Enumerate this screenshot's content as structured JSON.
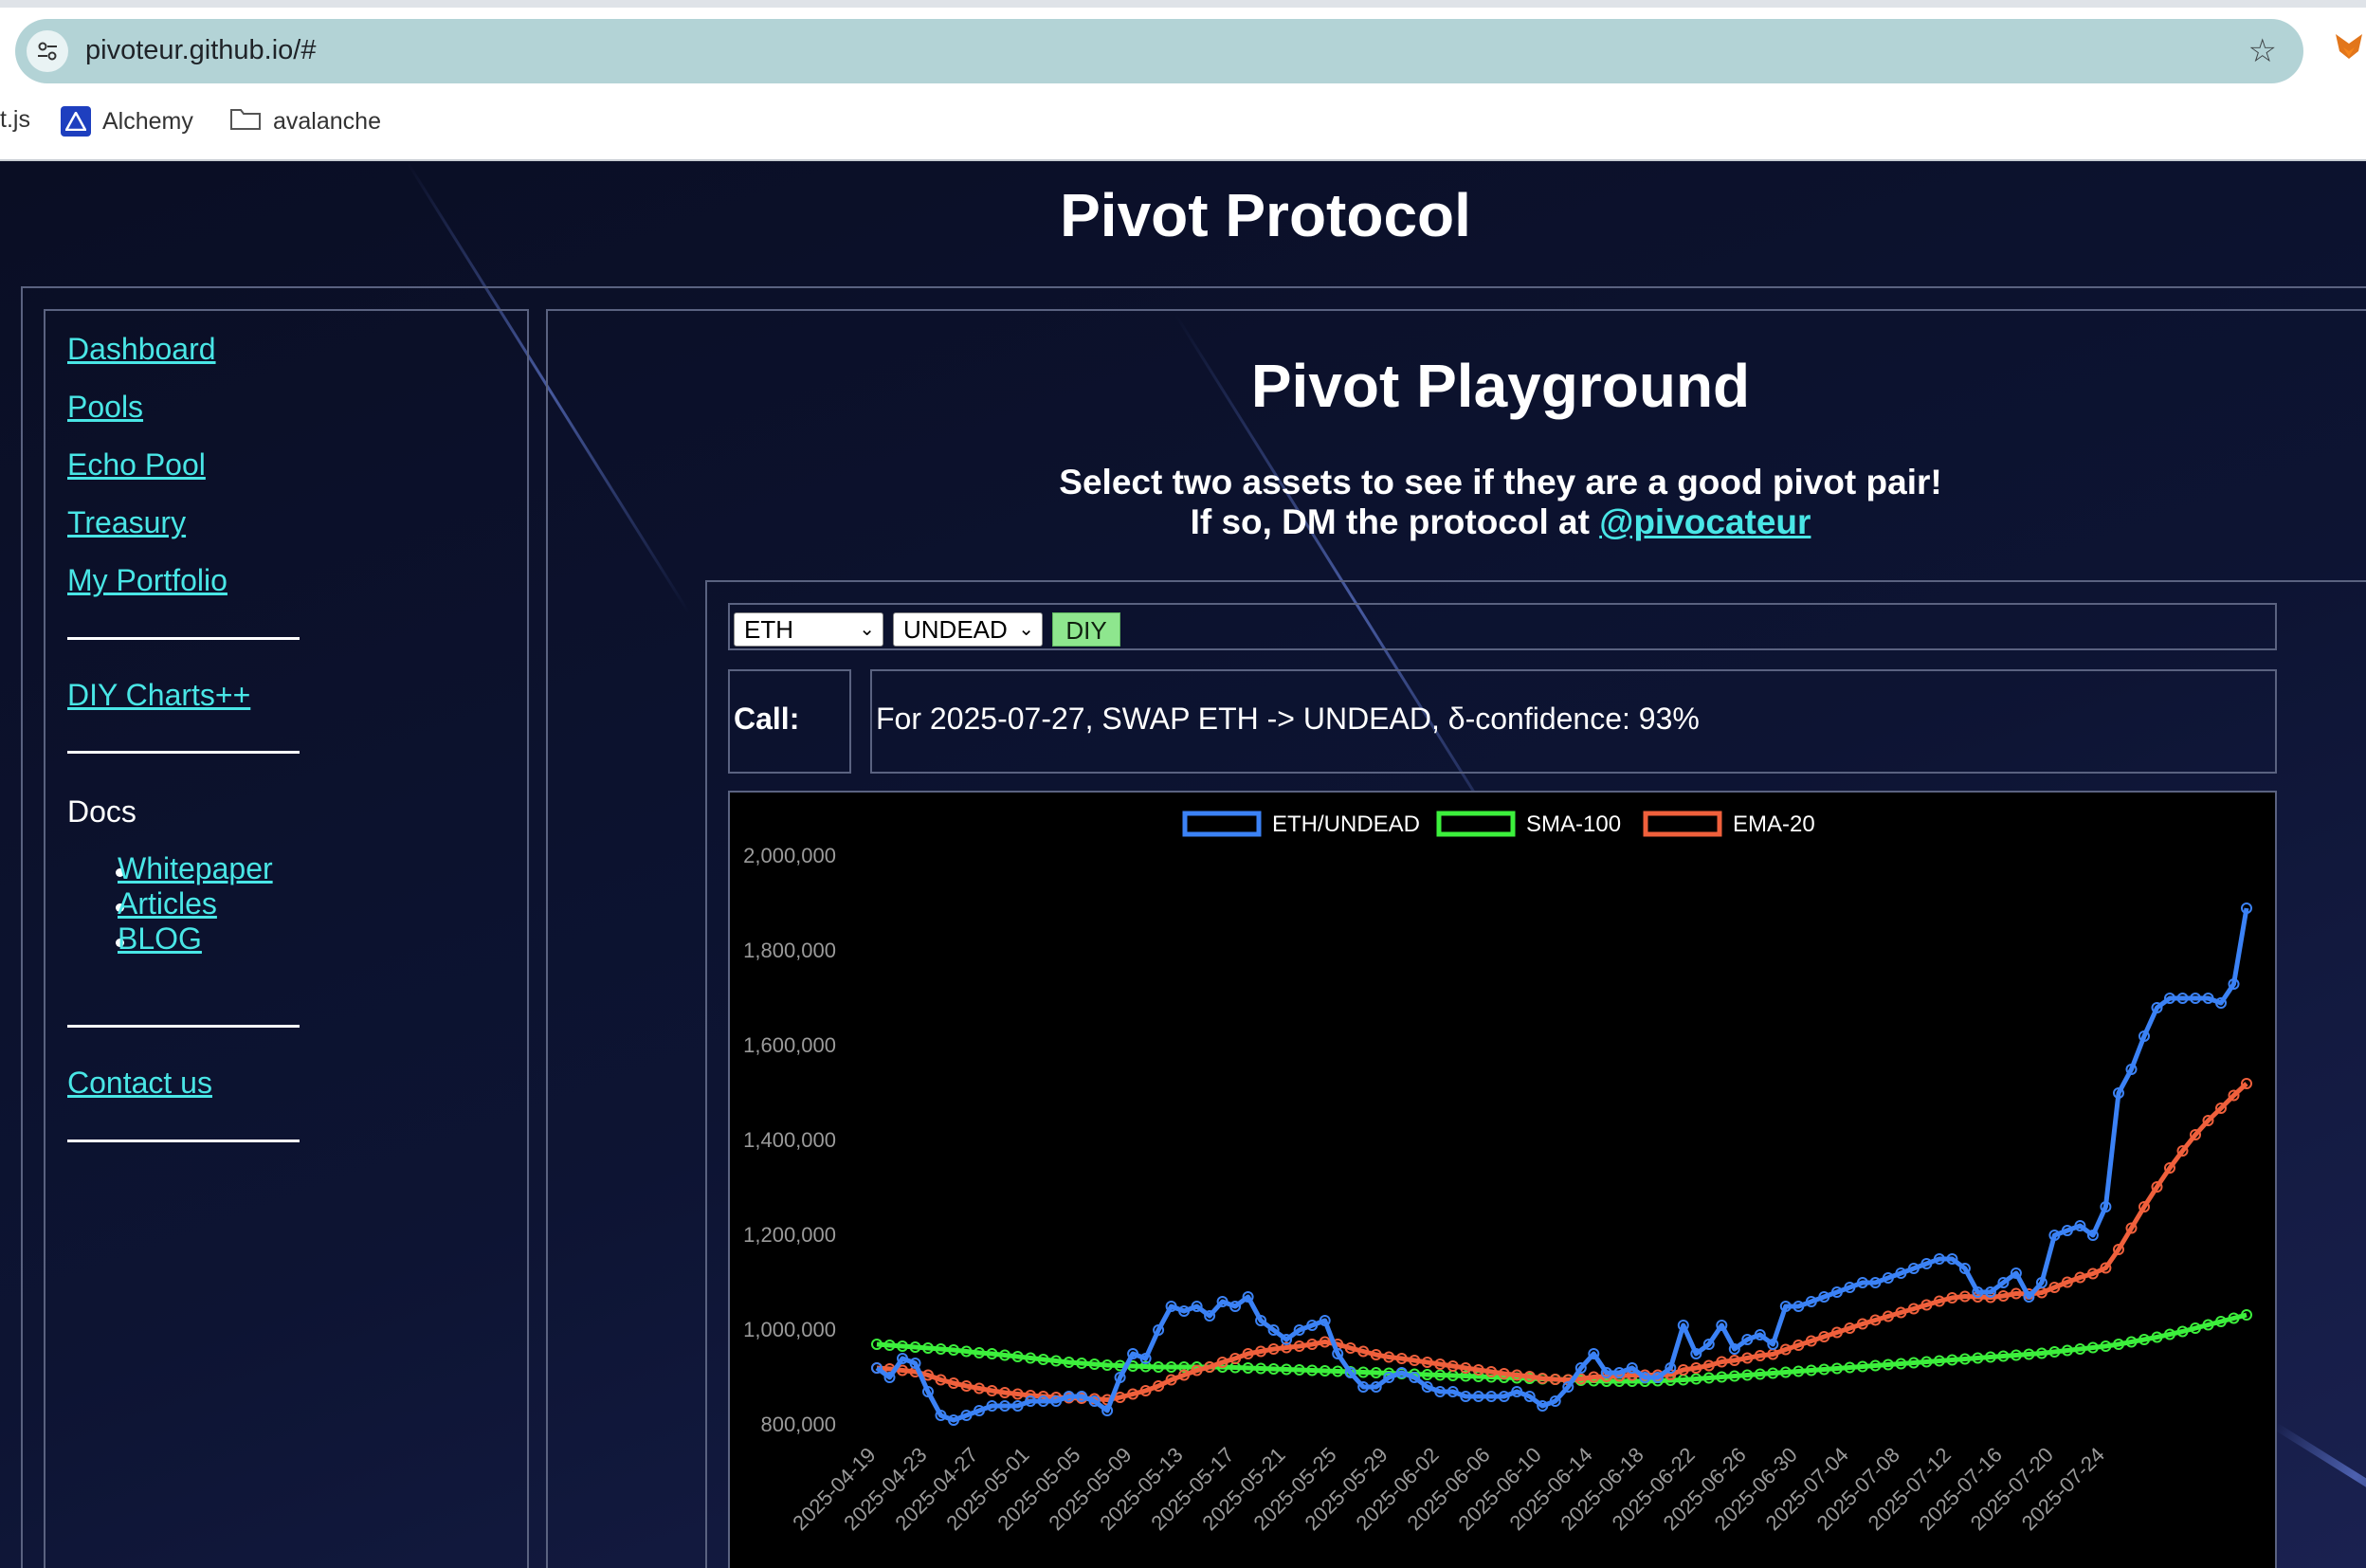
{
  "browser": {
    "url": "pivoteur.github.io/#",
    "bookmarks": [
      {
        "label": "t.js"
      },
      {
        "label": "Alchemy"
      },
      {
        "label": "avalanche"
      }
    ]
  },
  "site": {
    "title": "Pivot Protocol"
  },
  "sidebar": {
    "links": [
      {
        "label": "Dashboard"
      },
      {
        "label": "Pools"
      },
      {
        "label": "Echo Pool"
      },
      {
        "label": "Treasury"
      },
      {
        "label": "My Portfolio"
      }
    ],
    "diy": "DIY Charts++",
    "docs_label": "Docs",
    "docs": [
      "Whitepaper",
      "Articles",
      "BLOG"
    ],
    "contact": "Contact us"
  },
  "playground": {
    "title": "Pivot Playground",
    "subtitle1": "Select two assets to see if they are a good pivot pair!",
    "subtitle2_prefix": "If so, DM the protocol at ",
    "handle": "@pivocateur",
    "asset_a": "ETH",
    "asset_b": "UNDEAD",
    "diy_button": "DIY",
    "call_label": "Call:",
    "call_text": "For 2025-07-27, SWAP ETH -> UNDEAD, δ-confidence: 93%"
  },
  "colors": {
    "link": "#49e6e6",
    "eth_undead": "#3b82f6",
    "sma": "#3cf03c",
    "ema": "#f0603c"
  },
  "chart_data": {
    "type": "line",
    "ylim": [
      750000,
      2000000
    ],
    "yticks": [
      "800,000",
      "1,000,000",
      "1,200,000",
      "1,400,000",
      "1,600,000",
      "1,800,000",
      "2,000,000"
    ],
    "ytick_values": [
      800000,
      1000000,
      1200000,
      1400000,
      1600000,
      1800000,
      2000000
    ],
    "xtick_labels": [
      "2025-04-19",
      "2025-04-23",
      "2025-04-27",
      "2025-05-01",
      "2025-05-05",
      "2025-05-09",
      "2025-05-13",
      "2025-05-17",
      "2025-05-21",
      "2025-05-25",
      "2025-05-29",
      "2025-06-02",
      "2025-06-06",
      "2025-06-10",
      "2025-06-14",
      "2025-06-18",
      "2025-06-22",
      "2025-06-26",
      "2025-06-30",
      "2025-07-04",
      "2025-07-08",
      "2025-07-12",
      "2025-07-16",
      "2025-07-20",
      "2025-07-24"
    ],
    "x_start": "2025-04-19",
    "x_end": "2025-07-27",
    "legend_position": "top",
    "series": [
      {
        "name": "ETH/UNDEAD",
        "color": "#3b82f6",
        "values": [
          920000,
          900000,
          940000,
          930000,
          870000,
          820000,
          810000,
          820000,
          830000,
          840000,
          840000,
          840000,
          850000,
          850000,
          850000,
          860000,
          860000,
          850000,
          830000,
          900000,
          950000,
          940000,
          1000000,
          1050000,
          1040000,
          1050000,
          1030000,
          1060000,
          1050000,
          1070000,
          1020000,
          1000000,
          980000,
          1000000,
          1010000,
          1020000,
          950000,
          910000,
          880000,
          880000,
          900000,
          910000,
          900000,
          880000,
          870000,
          870000,
          860000,
          860000,
          860000,
          860000,
          870000,
          860000,
          840000,
          850000,
          880000,
          920000,
          950000,
          910000,
          910000,
          920000,
          900000,
          900000,
          920000,
          1010000,
          950000,
          970000,
          1010000,
          960000,
          980000,
          990000,
          970000,
          1050000,
          1050000,
          1060000,
          1070000,
          1080000,
          1090000,
          1100000,
          1100000,
          1110000,
          1120000,
          1130000,
          1140000,
          1150000,
          1150000,
          1130000,
          1080000,
          1080000,
          1100000,
          1120000,
          1070000,
          1100000,
          1200000,
          1210000,
          1220000,
          1200000,
          1260000,
          1500000,
          1550000,
          1620000,
          1680000,
          1700000,
          1700000,
          1700000,
          1700000,
          1690000,
          1730000,
          1890000
        ]
      },
      {
        "name": "SMA-100",
        "color": "#3cf03c",
        "values": [
          970000,
          968000,
          966000,
          964000,
          962000,
          960000,
          958000,
          955000,
          952000,
          950000,
          947000,
          944000,
          941000,
          938000,
          935000,
          932000,
          930000,
          928000,
          926000,
          925000,
          924000,
          923000,
          922000,
          922000,
          922000,
          922000,
          922000,
          922000,
          921000,
          920000,
          919000,
          918000,
          917000,
          916000,
          915000,
          914000,
          913000,
          912000,
          911000,
          910000,
          909000,
          908000,
          907000,
          906000,
          905000,
          904000,
          903000,
          902000,
          901000,
          900000,
          899000,
          898000,
          897000,
          896000,
          895000,
          894000,
          893000,
          892000,
          892000,
          892000,
          892000,
          893000,
          894000,
          895000,
          897000,
          899000,
          901000,
          903000,
          905000,
          907000,
          909000,
          911000,
          913000,
          915000,
          917000,
          919000,
          921000,
          923000,
          925000,
          927000,
          929000,
          931000,
          933000,
          935000,
          937000,
          939000,
          941000,
          943000,
          945000,
          947000,
          949000,
          951000,
          954000,
          957000,
          960000,
          963000,
          966000,
          970000,
          975000,
          980000,
          985000,
          991000,
          997000,
          1004000,
          1011000,
          1018000,
          1025000,
          1032000
        ]
      },
      {
        "name": "EMA-20",
        "color": "#f0603c",
        "values": [
          920000,
          918000,
          915000,
          912000,
          905000,
          895000,
          888000,
          882000,
          877000,
          872000,
          868000,
          865000,
          862000,
          860000,
          858000,
          857000,
          856000,
          855000,
          853000,
          858000,
          865000,
          872000,
          882000,
          895000,
          905000,
          915000,
          922000,
          932000,
          940000,
          950000,
          955000,
          960000,
          963000,
          966000,
          970000,
          975000,
          970000,
          962000,
          955000,
          948000,
          943000,
          940000,
          936000,
          932000,
          928000,
          924000,
          920000,
          916000,
          912000,
          908000,
          905000,
          902000,
          898000,
          896000,
          895000,
          897000,
          901000,
          902000,
          903000,
          905000,
          905000,
          905000,
          906000,
          916000,
          920000,
          925000,
          933000,
          936000,
          941000,
          946000,
          949000,
          959000,
          968000,
          977000,
          986000,
          995000,
          1004000,
          1013000,
          1021000,
          1029000,
          1037000,
          1045000,
          1053000,
          1061000,
          1068000,
          1071000,
          1070000,
          1069000,
          1072000,
          1077000,
          1076000,
          1079000,
          1090000,
          1101000,
          1111000,
          1119000,
          1131000,
          1170000,
          1215000,
          1260000,
          1302000,
          1342000,
          1378000,
          1412000,
          1442000,
          1468000,
          1495000,
          1520000
        ]
      }
    ]
  }
}
